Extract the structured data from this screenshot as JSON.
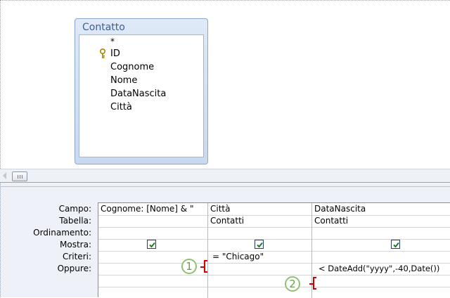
{
  "table": {
    "title": "Contatto",
    "fields": [
      "*",
      "ID",
      "Cognome",
      "Nome",
      "DataNascita",
      "Città"
    ]
  },
  "row_labels": [
    "Campo:",
    "Tabella:",
    "Ordinamento:",
    "Mostra:",
    "Criteri:",
    "Oppure:"
  ],
  "columns": [
    {
      "campo": "Cognome: [Nome] & \"",
      "tabella": "",
      "mostra": true,
      "criteri": "",
      "oppure": ""
    },
    {
      "campo": "Città",
      "tabella": "Contatti",
      "mostra": true,
      "criteri": "= \"Chicago\"",
      "oppure": ""
    },
    {
      "campo": "DataNascita",
      "tabella": "Contatti",
      "mostra": true,
      "criteri": "",
      "oppure": "< DateAdd(\"yyyy\",-40,Date())"
    }
  ],
  "callouts": [
    "1",
    "2"
  ],
  "icons": {
    "key": "key-icon",
    "scroll_left": "arrow-left-icon",
    "check": "checkmark-icon"
  },
  "colors": {
    "callout": "#8ec26f",
    "bracket": "#d40000",
    "table_border": "#8aa7cf"
  }
}
